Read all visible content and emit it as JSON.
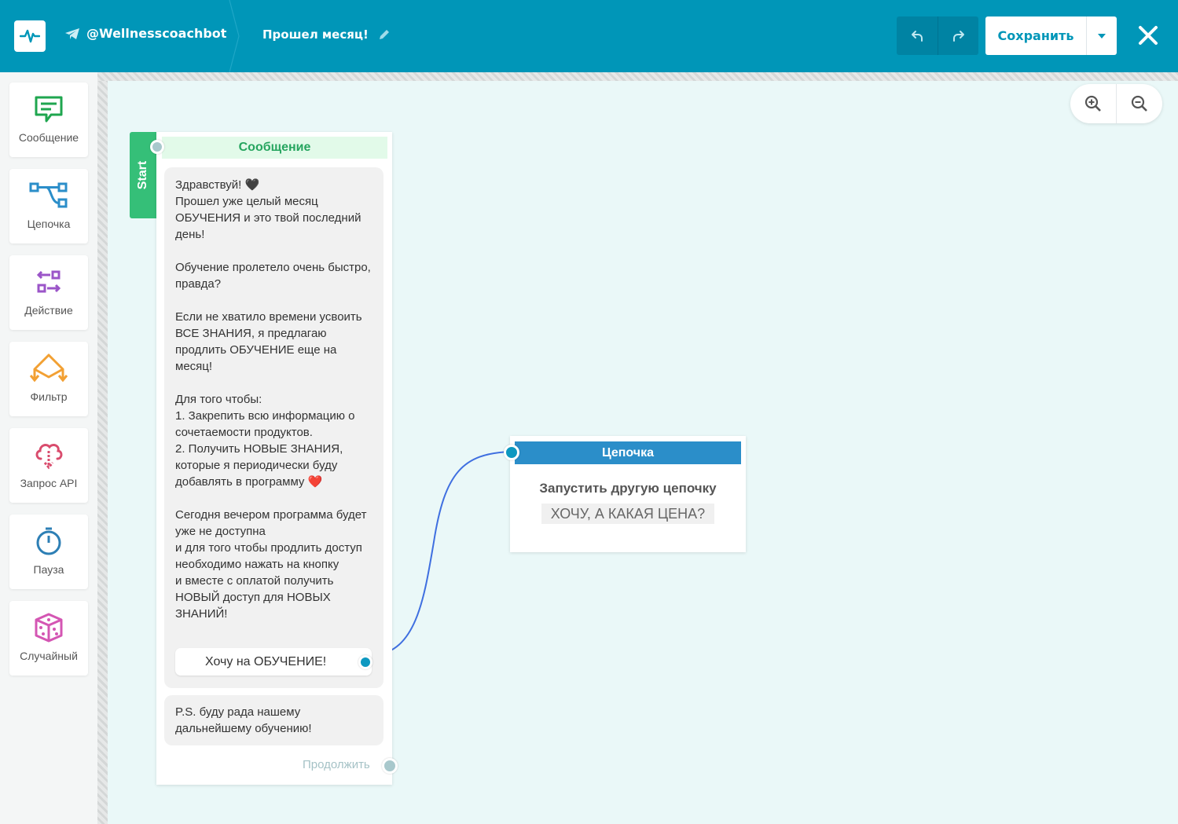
{
  "header": {
    "bot_name": "@Wellnesscoachbot",
    "flow_title": "Прошел месяц!",
    "save_label": "Сохранить"
  },
  "icons": {
    "logo": "pulse-icon",
    "bot": "telegram-icon",
    "edit": "pencil-icon",
    "undo": "undo-icon",
    "redo": "redo-icon",
    "save_menu": "chevron-down-icon",
    "close": "close-icon",
    "zoom_in": "zoom-in-icon",
    "zoom_out": "zoom-out-icon"
  },
  "sidebar": {
    "items": [
      {
        "label": "Сообщение",
        "icon": "message-icon",
        "color": "#1fa64f"
      },
      {
        "label": "Цепочка",
        "icon": "chain-icon",
        "color": "#2b8ec9"
      },
      {
        "label": "Действие",
        "icon": "action-icon",
        "color": "#9b55c8"
      },
      {
        "label": "Фильтр",
        "icon": "filter-icon",
        "color": "#f2a033"
      },
      {
        "label": "Запрос API",
        "icon": "api-cloud-icon",
        "color": "#d94c6d"
      },
      {
        "label": "Пауза",
        "icon": "timer-icon",
        "color": "#2d7fb5"
      },
      {
        "label": "Случайный",
        "icon": "dice-icon",
        "color": "#d456b3"
      }
    ]
  },
  "canvas": {
    "start_label": "Start",
    "message_node": {
      "header": "Сообщение",
      "text": "Здравствуй! 🖤\nПрошел уже целый месяц ОБУЧЕНИЯ и это твой последний день!\n\nОбучение пролетело очень быстро, правда?\n\nЕсли не хватило времени усвоить ВСЕ ЗНАНИЯ, я предлагаю продлить ОБУЧЕНИЕ еще на месяц!\n\nДля того чтобы:\n1. Закрепить всю информацию о сочетаемости продуктов.\n2. Получить НОВЫЕ ЗНАНИЯ, которые я периодически буду добавлять в программу ❤️\n\nСегодня вечером программа будет уже не доступна\nи для того чтобы продлить доступ необходимо нажать на кнопку\nи вместе с оплатой получить НОВЫЙ доступ для НОВЫХ ЗНАНИЙ!",
      "button_label": "Хочу на ОБУЧЕНИЕ!",
      "text2": "P.S. буду рада нашему дальнейшему обучению!",
      "continue_label": "Продолжить"
    },
    "chain_node": {
      "header": "Цепочка",
      "title": "Запустить другую цепочку",
      "target": "ХОЧУ, А КАКАЯ ЦЕНА?"
    }
  },
  "colors": {
    "header_bg": "#0096b8",
    "canvas_bg": "#eaf8f8",
    "start_green": "#35bf78",
    "chain_blue": "#2b8ec9",
    "connector": "#3f6fe0"
  }
}
